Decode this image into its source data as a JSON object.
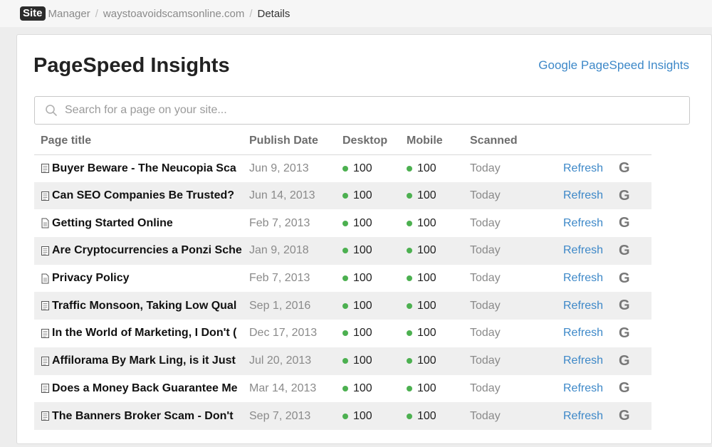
{
  "breadcrumb": {
    "logo_site": "Site",
    "logo_manager": "Manager",
    "separator": "/",
    "site": "waystoavoidscamsonline.com",
    "current": "Details"
  },
  "header": {
    "title": "PageSpeed Insights",
    "external_link": "Google PageSpeed Insights"
  },
  "search": {
    "placeholder": "Search for a page on your site..."
  },
  "table": {
    "columns": {
      "title": "Page title",
      "date": "Publish Date",
      "desktop": "Desktop",
      "mobile": "Mobile",
      "scanned": "Scanned"
    },
    "rows": [
      {
        "title": "Buyer Beware - The Neucopia Sca",
        "date": "Jun 9, 2013",
        "desktop": "100",
        "mobile": "100",
        "scanned": "Today",
        "refresh": "Refresh",
        "g": "G",
        "icon": "article"
      },
      {
        "title": "Can SEO Companies Be Trusted?",
        "date": "Jun 14, 2013",
        "desktop": "100",
        "mobile": "100",
        "scanned": "Today",
        "refresh": "Refresh",
        "g": "G",
        "icon": "article"
      },
      {
        "title": "Getting Started Online",
        "date": "Feb 7, 2013",
        "desktop": "100",
        "mobile": "100",
        "scanned": "Today",
        "refresh": "Refresh",
        "g": "G",
        "icon": "page"
      },
      {
        "title": "Are Cryptocurrencies a Ponzi Sche",
        "date": "Jan 9, 2018",
        "desktop": "100",
        "mobile": "100",
        "scanned": "Today",
        "refresh": "Refresh",
        "g": "G",
        "icon": "article"
      },
      {
        "title": "Privacy Policy",
        "date": "Feb 7, 2013",
        "desktop": "100",
        "mobile": "100",
        "scanned": "Today",
        "refresh": "Refresh",
        "g": "G",
        "icon": "page"
      },
      {
        "title": "Traffic Monsoon, Taking Low Qual",
        "date": "Sep 1, 2016",
        "desktop": "100",
        "mobile": "100",
        "scanned": "Today",
        "refresh": "Refresh",
        "g": "G",
        "icon": "article"
      },
      {
        "title": "In the World of Marketing, I Don't (",
        "date": "Dec 17, 2013",
        "desktop": "100",
        "mobile": "100",
        "scanned": "Today",
        "refresh": "Refresh",
        "g": "G",
        "icon": "article"
      },
      {
        "title": "Affilorama By Mark Ling, is it Just",
        "date": "Jul 20, 2013",
        "desktop": "100",
        "mobile": "100",
        "scanned": "Today",
        "refresh": "Refresh",
        "g": "G",
        "icon": "article"
      },
      {
        "title": "Does a Money Back Guarantee Me",
        "date": "Mar 14, 2013",
        "desktop": "100",
        "mobile": "100",
        "scanned": "Today",
        "refresh": "Refresh",
        "g": "G",
        "icon": "article"
      },
      {
        "title": "The Banners Broker Scam - Don't",
        "date": "Sep 7, 2013",
        "desktop": "100",
        "mobile": "100",
        "scanned": "Today",
        "refresh": "Refresh",
        "g": "G",
        "icon": "article"
      }
    ]
  },
  "colors": {
    "link": "#3d88c8",
    "status_good": "#4cb050",
    "row_alt": "#efefef"
  }
}
